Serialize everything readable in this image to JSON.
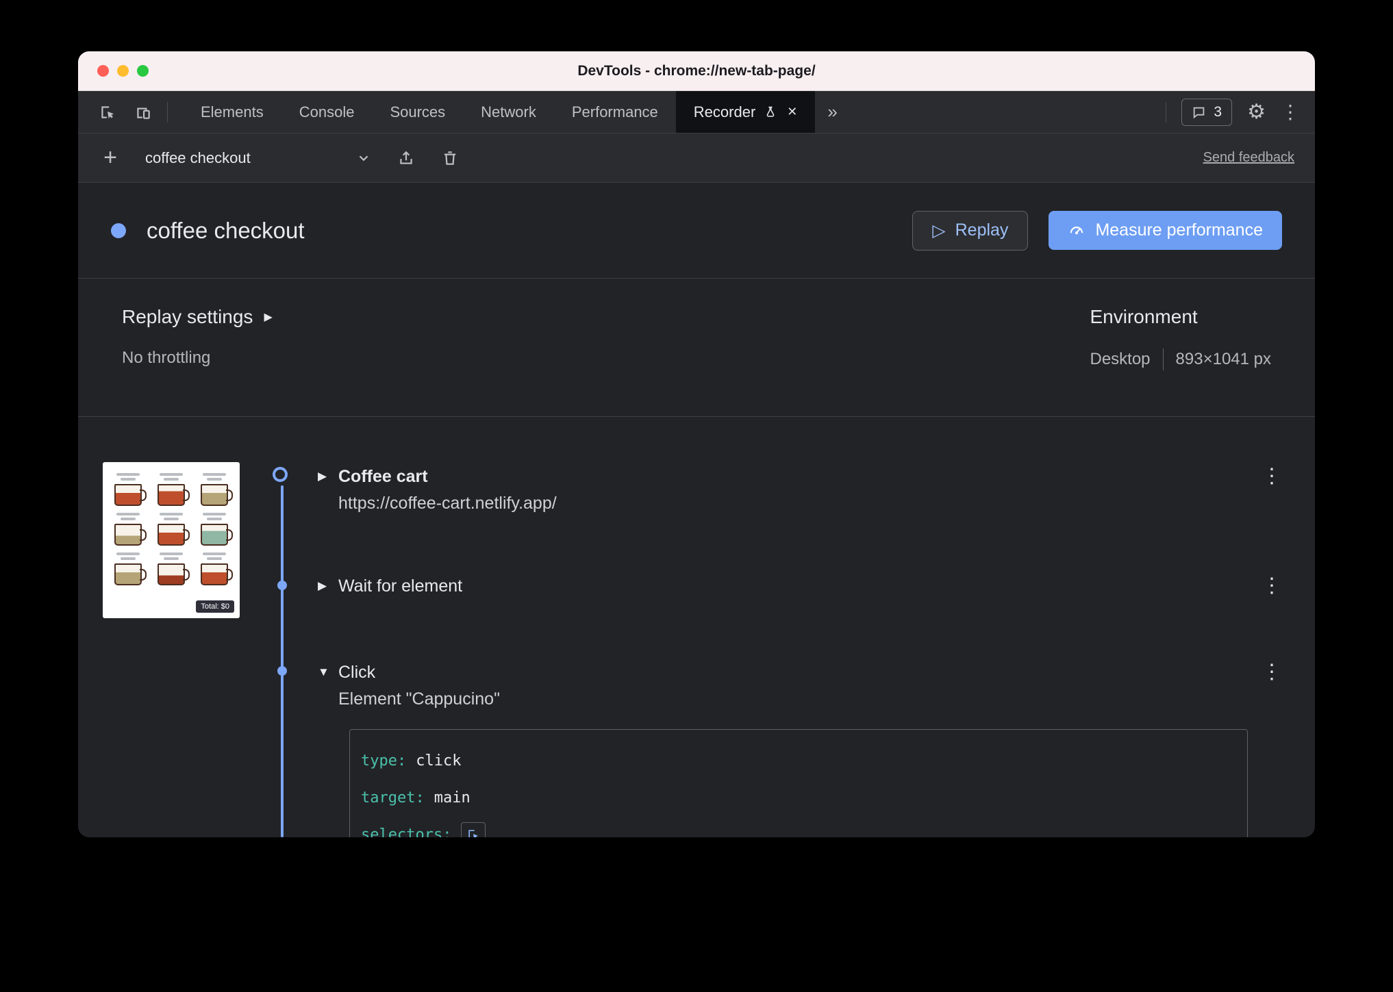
{
  "window": {
    "title": "DevTools - chrome://new-tab-page/"
  },
  "tab_bar": {
    "tabs": [
      "Elements",
      "Console",
      "Sources",
      "Network",
      "Performance"
    ],
    "active_tab": "Recorder",
    "messages_count": "3"
  },
  "recorder_toolbar": {
    "recording_name": "coffee checkout",
    "send_feedback_label": "Send feedback"
  },
  "recording_header": {
    "title": "coffee checkout",
    "replay_label": "Replay",
    "measure_performance_label": "Measure performance"
  },
  "replay_settings": {
    "label": "Replay settings",
    "throttling": "No throttling"
  },
  "environment": {
    "label": "Environment",
    "device": "Desktop",
    "viewport": "893×1041 px"
  },
  "steps": [
    {
      "title": "Coffee cart",
      "url": "https://coffee-cart.netlify.app/"
    },
    {
      "title": "Wait for element"
    },
    {
      "title": "Click",
      "subtitle": "Element \"Cappucino\"",
      "code": [
        {
          "label": "type:",
          "value": "click"
        },
        {
          "label": "target:",
          "value": "main"
        },
        {
          "label": "selectors:",
          "value": ""
        }
      ]
    }
  ],
  "thumbnail": {
    "badge": "Total: $0"
  },
  "icons": {
    "plus": "+",
    "overflow": "»",
    "close": "✕",
    "gear": "⚙",
    "kebab": "⋮",
    "play": "▷",
    "collapsed": "▶",
    "expanded": "▼"
  },
  "colors": {
    "accent_blue": "#7da7f8",
    "primary_button_blue": "#6d9ef3",
    "code_key_teal": "#4bc1ab",
    "titlebar_pink": "#f8eff1"
  }
}
